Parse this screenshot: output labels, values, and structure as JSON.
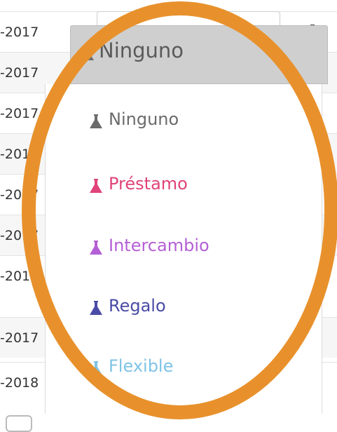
{
  "rows": [
    {
      "date": "-2017",
      "actions": true
    },
    {
      "date": "-2017",
      "actions": true
    },
    {
      "date": "-2017",
      "actions": false
    },
    {
      "date": "-2017",
      "actions": false
    },
    {
      "date": "-2017",
      "actions": false
    },
    {
      "date": "-2017",
      "actions": false
    },
    {
      "date": "-2017",
      "actions": false
    },
    {
      "date": "-2017",
      "actions": true
    },
    {
      "date": "-2018",
      "actions": true
    }
  ],
  "dropdown": {
    "selected": {
      "label": "Ninguno",
      "color": "#6e6e6e"
    },
    "options": [
      {
        "label": "Ninguno",
        "color": "#6b6b6b",
        "icon": "flask-icon"
      },
      {
        "label": "Préstamo",
        "color": "#e0437a",
        "icon": "flask-icon"
      },
      {
        "label": "Intercambio",
        "color": "#b45fd6",
        "icon": "flask-icon"
      },
      {
        "label": "Regalo",
        "color": "#4a4ba6",
        "icon": "flask-icon"
      },
      {
        "label": "Flexible",
        "color": "#7fc3e6",
        "icon": "flask-icon"
      }
    ]
  },
  "icons": {
    "edit": "pencil-icon",
    "delete": "trash-icon"
  },
  "highlight": {
    "color": "#e8912c"
  }
}
